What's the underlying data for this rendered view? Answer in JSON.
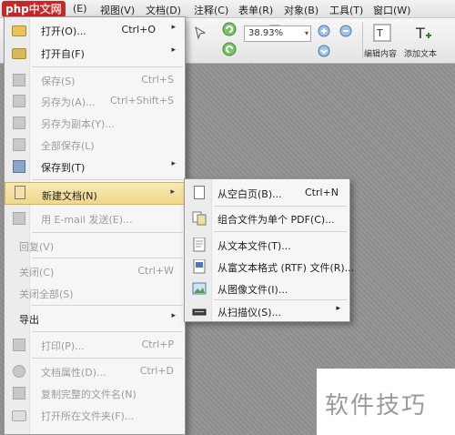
{
  "logo": {
    "main": "php",
    "sub": "中文网"
  },
  "menubar": {
    "items": [
      "视图(V)",
      "文档(D)",
      "注释(C)",
      "表单(R)",
      "对象(B)",
      "工具(T)",
      "窗口(W)"
    ],
    "hidden_prefix": "(E)"
  },
  "toolbar": {
    "zoom_value": "38.93%",
    "edit_content_label": "编辑内容",
    "add_text_label": "添加文本"
  },
  "file_menu": {
    "items": [
      {
        "label": "打开(O)...",
        "shortcut": "Ctrl+O",
        "submenu": true,
        "enabled": true,
        "icon": "folder-open-icon"
      },
      {
        "label": "打开自(F)",
        "shortcut": "",
        "submenu": true,
        "enabled": true,
        "icon": "folder-open-from-icon"
      },
      {
        "label": "保存(S)",
        "shortcut": "Ctrl+S",
        "submenu": false,
        "enabled": false,
        "icon": "save-icon"
      },
      {
        "label": "另存为(A)...",
        "shortcut": "Ctrl+Shift+S",
        "submenu": false,
        "enabled": false,
        "icon": "save-as-icon"
      },
      {
        "label": "另存为副本(Y)...",
        "shortcut": "",
        "submenu": false,
        "enabled": false,
        "icon": "save-copy-icon"
      },
      {
        "label": "全部保存(L)",
        "shortcut": "",
        "submenu": false,
        "enabled": false,
        "icon": "save-all-icon"
      },
      {
        "label": "保存到(T)",
        "shortcut": "",
        "submenu": true,
        "enabled": true,
        "icon": "save-to-icon"
      },
      {
        "label": "新建文档(N)",
        "shortcut": "",
        "submenu": true,
        "enabled": true,
        "icon": "new-document-icon",
        "active": true
      },
      {
        "label": "用 E-mail 发送(E)...",
        "shortcut": "",
        "submenu": false,
        "enabled": false,
        "icon": "email-icon"
      },
      {
        "label": "回复(V)",
        "shortcut": "",
        "submenu": false,
        "enabled": false,
        "icon": ""
      },
      {
        "label": "关闭(C)",
        "shortcut": "Ctrl+W",
        "submenu": false,
        "enabled": false,
        "icon": ""
      },
      {
        "label": "关闭全部(S)",
        "shortcut": "",
        "submenu": false,
        "enabled": false,
        "icon": ""
      },
      {
        "label": "导出",
        "shortcut": "",
        "submenu": true,
        "enabled": true,
        "icon": ""
      },
      {
        "label": "打印(P)...",
        "shortcut": "Ctrl+P",
        "submenu": false,
        "enabled": false,
        "icon": "print-icon"
      },
      {
        "label": "文档属性(D)...",
        "shortcut": "Ctrl+D",
        "submenu": false,
        "enabled": false,
        "icon": "properties-icon"
      },
      {
        "label": "复制完整的文件名(N)",
        "shortcut": "",
        "submenu": false,
        "enabled": false,
        "icon": "copy-filename-icon"
      },
      {
        "label": "打开所在文件夹(F)...",
        "shortcut": "",
        "submenu": false,
        "enabled": false,
        "icon": "open-folder-icon"
      }
    ]
  },
  "new_doc_submenu": {
    "items": [
      {
        "label": "从空白页(B)...",
        "shortcut": "Ctrl+N",
        "submenu": false,
        "icon": "blank-page-icon"
      },
      {
        "label": "组合文件为单个 PDF(C)...",
        "shortcut": "",
        "submenu": false,
        "icon": "combine-files-icon"
      },
      {
        "label": "从文本文件(T)...",
        "shortcut": "",
        "submenu": false,
        "icon": "text-file-icon"
      },
      {
        "label": "从富文本格式 (RTF) 文件(R)...",
        "shortcut": "",
        "submenu": false,
        "icon": "rtf-file-icon"
      },
      {
        "label": "从图像文件(I)...",
        "shortcut": "",
        "submenu": false,
        "icon": "image-file-icon"
      },
      {
        "label": "从扫描仪(S)...",
        "shortcut": "",
        "submenu": true,
        "icon": "scanner-icon"
      }
    ]
  },
  "watermark": "软件技巧",
  "glyphs": {
    "submenu_arrow": "▸",
    "dropdown_arrow": "▾"
  }
}
